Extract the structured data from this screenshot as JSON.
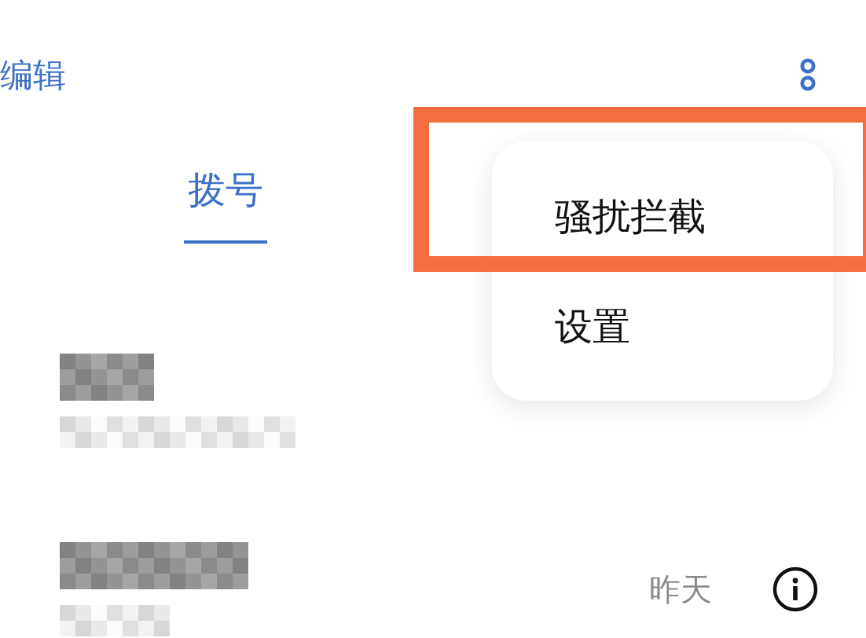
{
  "header": {
    "edit_label": "编辑"
  },
  "tabs": [
    {
      "label": "拨号",
      "selected": true
    }
  ],
  "calls": [
    {
      "kind": "pixelated"
    },
    {
      "kind": "pixelated",
      "time": "昨天"
    }
  ],
  "menu": {
    "items": [
      {
        "label": "骚扰拦截",
        "highlighted": true
      },
      {
        "label": "设置",
        "highlighted": false
      }
    ]
  }
}
